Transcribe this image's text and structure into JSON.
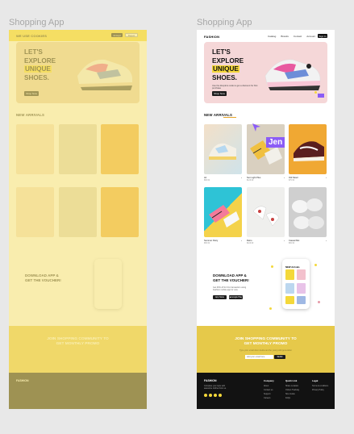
{
  "frames": {
    "left_label": "Shopping App",
    "right_label": "Shopping App"
  },
  "left": {
    "topbar_title": "WE USE COOKIES",
    "topbar_btn1": "Accept",
    "topbar_btn2": "Reject"
  },
  "nav": {
    "brand": "FASHION",
    "links": [
      "Catalog",
      "Brands",
      "Contact",
      "Account"
    ],
    "cta": "Sign In"
  },
  "hero": {
    "line1": "LET'S",
    "line2": "EXPLORE",
    "line3": "UNIQUE",
    "line4": "SHOES.",
    "sub": "Use the #explore code to get a discount for first purchase",
    "button": "Shop Now"
  },
  "arrivals": {
    "title": "NEW ARRIVALS",
    "cursor_tag": "Jen",
    "products": [
      {
        "name": "Air",
        "price": "$99.99",
        "style": "pastel"
      },
      {
        "name": "Sun Light Plus",
        "price": "$129.99",
        "style": "sunlight"
      },
      {
        "name": "Old Skool",
        "price": "$79.99",
        "style": "vans-orange"
      },
      {
        "name": "Summer Party",
        "price": "$89.99",
        "style": "party"
      },
      {
        "name": "Retro",
        "price": "$109.99",
        "style": "retro"
      },
      {
        "name": "Casual Mix",
        "price": "$69.99",
        "style": "whites"
      }
    ]
  },
  "app": {
    "title_l1": "DOWNLOAD APP &",
    "title_l2": "GET THE VOUCHER!",
    "sub": "Get 30% off for first transaction using Fashion mobile app for now.",
    "apple": "App Store",
    "google": "Google Play",
    "phone_header": "NEW Arrivals"
  },
  "newsletter": {
    "title_l1": "JOIN SHOPPING COMMUNITY TO",
    "title_l2": "GET MONTHLY PROMO",
    "sub": "Type your email down below and be young wild generation",
    "placeholder": "Add your email here",
    "button": "SEND"
  },
  "footer": {
    "brand": "FASHION",
    "desc": "Complete your style with awesome clothes from us.",
    "columns": [
      {
        "title": "Company",
        "items": [
          "About",
          "Contact us",
          "Support",
          "Careers"
        ]
      },
      {
        "title": "Quick Link",
        "items": [
          "Share Location",
          "Orders Tracking",
          "Size Guide",
          "FAQs"
        ]
      },
      {
        "title": "Legal",
        "items": [
          "Terms & conditions",
          "Privacy Policy"
        ]
      }
    ]
  },
  "colors": {
    "accent_yellow": "#f4d83a",
    "newsletter_bg": "#e6c94a",
    "footer_bg": "#121212",
    "cursor_purple": "#8b5cf6",
    "canvas": "#e8e8e8"
  }
}
